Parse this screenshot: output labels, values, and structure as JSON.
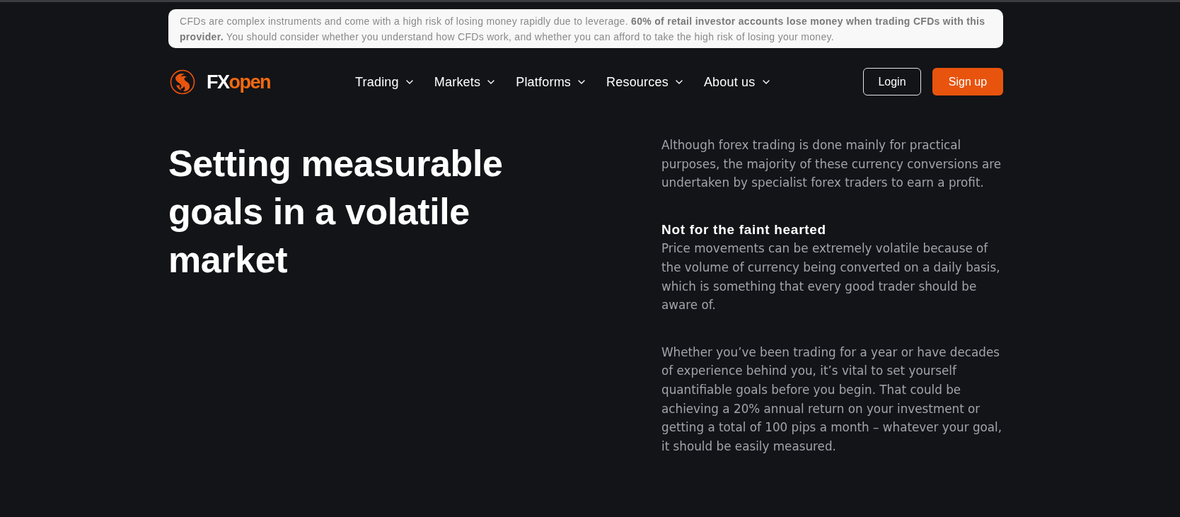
{
  "risk_banner": {
    "text": "CFDs are complex instruments and come with a high risk of losing money rapidly due to leverage. **60% of retail investor accounts lose money when trading CFDs with this provider.** You should consider whether you understand how CFDs work, and whether you can afford to take the high risk of losing your money."
  },
  "header": {
    "logo": {
      "wordmark_prefix": "FX",
      "wordmark_suffix": "open"
    },
    "nav": [
      {
        "label": "Trading"
      },
      {
        "label": "Markets"
      },
      {
        "label": "Platforms"
      },
      {
        "label": "Resources"
      },
      {
        "label": "About us"
      }
    ],
    "buttons": [
      {
        "label": "Login",
        "kind": "outline"
      },
      {
        "label": "Sign up",
        "kind": "primary"
      }
    ]
  },
  "article": {
    "title": "Setting measurable goals in a volatile market",
    "blocks": [
      {
        "kind": "paragraph",
        "text": "Although forex trading is done mainly for practical purposes, the majority of these currency conversions are undertaken by specialist forex traders to earn a profit."
      },
      {
        "kind": "heading",
        "text": "Not for the faint hearted"
      },
      {
        "kind": "paragraph",
        "text": "Price movements can be extremely volatile because of the volume of currency being converted on a daily basis, which is something that every good trader should be aware of."
      },
      {
        "kind": "paragraph",
        "text": "Whether you’ve been trading for a year or have decades of experience behind you, it’s vital to set yourself quantifiable goals before you begin. That could be achieving a 20% annual return on your investment or getting a total of 100 pips a month – whatever your goal, it should be easily measured."
      }
    ]
  }
}
